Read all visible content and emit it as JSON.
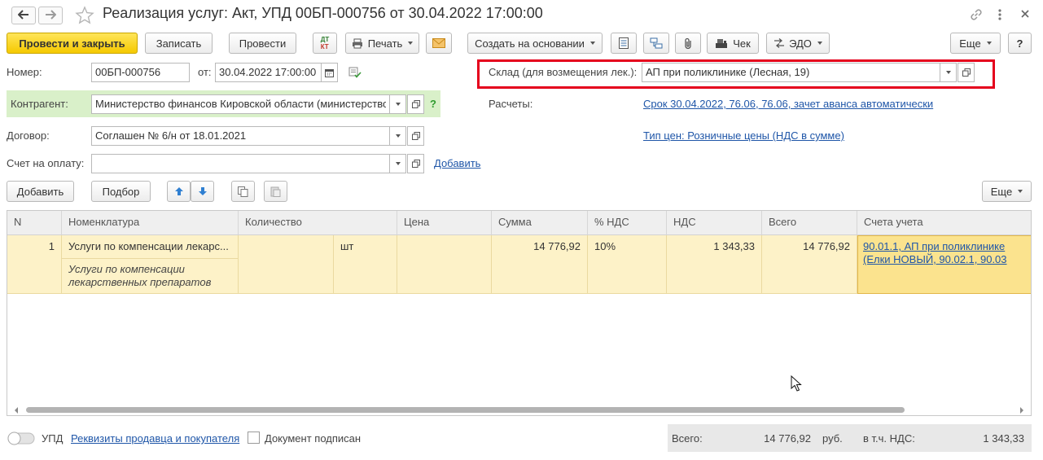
{
  "window": {
    "title": "Реализация услуг: Акт, УПД 00БП-000756 от 30.04.2022 17:00:00"
  },
  "toolbar": {
    "post_close": "Провести и закрыть",
    "save": "Записать",
    "post": "Провести",
    "print": "Печать",
    "create_based": "Создать на основании",
    "check": "Чек",
    "edo": "ЭДО",
    "more": "Еще",
    "help": "?",
    "dtkt_top": "ДТ",
    "dtkt_bottom": "КТ"
  },
  "form": {
    "number_label": "Номер:",
    "number_value": "00БП-000756",
    "date_label": "от:",
    "date_value": "30.04.2022 17:00:00",
    "warehouse_label": "Склад (для возмещения лек.):",
    "warehouse_value": "АП при поликлинике (Лесная, 19)",
    "counterparty_label": "Контрагент:",
    "counterparty_value": "Министерство финансов Кировской области (министерство з",
    "counterparty_help": "?",
    "settlements_label": "Расчеты:",
    "settlements_link": "Срок 30.04.2022, 76.06, 76.06, зачет аванса автоматически",
    "contract_label": "Договор:",
    "contract_value": "Соглашен № 6/н от 18.01.2021",
    "price_type_link": "Тип цен: Розничные цены (НДС в сумме)",
    "invoice_label": "Счет на оплату:",
    "invoice_value": "",
    "invoice_add": "Добавить"
  },
  "table_toolbar": {
    "add": "Добавить",
    "pick": "Подбор",
    "more": "Еще"
  },
  "table": {
    "headers": [
      "N",
      "Номенклатура",
      "Количество",
      "Цена",
      "Сумма",
      "% НДС",
      "НДС",
      "Всего",
      "Счета учета"
    ],
    "rows": [
      {
        "n": "1",
        "item": "Услуги по компенсации лекарс...",
        "item_desc": "Услуги по компенсации лекарственных препаратов",
        "quantity": "",
        "unit": "шт",
        "price": "",
        "sum": "14 776,92",
        "vat_rate": "10%",
        "vat": "1 343,33",
        "total": "14 776,92",
        "accounts": "90.01.1, АП при поликлинике (Елки НОВЫЙ, 90.02.1, 90.03"
      }
    ]
  },
  "footer": {
    "upd_label": "УПД",
    "requisites_link": "Реквизиты продавца и покупателя",
    "signed_label": "Документ подписан",
    "total_label": "Всего:",
    "total_value": "14 776,92",
    "currency": "руб.",
    "vat_label": "в т.ч. НДС:",
    "vat_value": "1 343,33"
  },
  "colors": {
    "primary_button": "#f5c900",
    "highlight_frame": "#e5001c",
    "counterparty_bg": "#d9f0c9",
    "row_bg": "#fdf2c8",
    "selected_cell": "#fbe38e",
    "link": "#1f56a8"
  }
}
